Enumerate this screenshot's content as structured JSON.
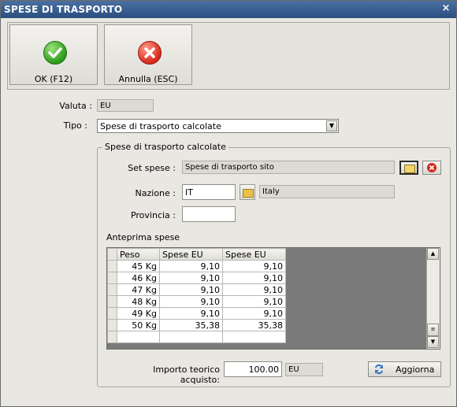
{
  "window": {
    "title": "SPESE DI TRASPORTO",
    "close_glyph": "×"
  },
  "toolbar": {
    "ok_label": "OK (F12)",
    "cancel_label": "Annulla (ESC)"
  },
  "form": {
    "valuta_label": "Valuta :",
    "valuta_value": "EU",
    "tipo_label": "Tipo :",
    "tipo_value": "Spese di trasporto calcolate"
  },
  "group": {
    "title": "Spese di trasporto calcolate",
    "set_spese_label": "Set spese :",
    "set_spese_value": "Spese di trasporto sito",
    "nazione_label": "Nazione :",
    "nazione_value": "IT",
    "nazione_name": "Italy",
    "provincia_label": "Provincia :",
    "provincia_value": "",
    "anteprima_label": "Anteprima spese"
  },
  "table": {
    "columns": [
      "Peso",
      "Spese EU",
      "Spese EU"
    ],
    "rows": [
      [
        "45 Kg",
        "9,10",
        "9,10"
      ],
      [
        "46 Kg",
        "9,10",
        "9,10"
      ],
      [
        "47 Kg",
        "9,10",
        "9,10"
      ],
      [
        "48 Kg",
        "9,10",
        "9,10"
      ],
      [
        "49 Kg",
        "9,10",
        "9,10"
      ],
      [
        "50 Kg",
        "35,38",
        "35,38"
      ]
    ]
  },
  "footer": {
    "importo_label": "Importo teorico acquisto:",
    "importo_value": "100.00",
    "importo_currency": "EU",
    "aggiorna_label": "Aggiorna"
  },
  "colors": {
    "title_bar": "#2a4f80",
    "ok_icon": "#2c9a1c",
    "cancel_icon": "#d6281a"
  }
}
